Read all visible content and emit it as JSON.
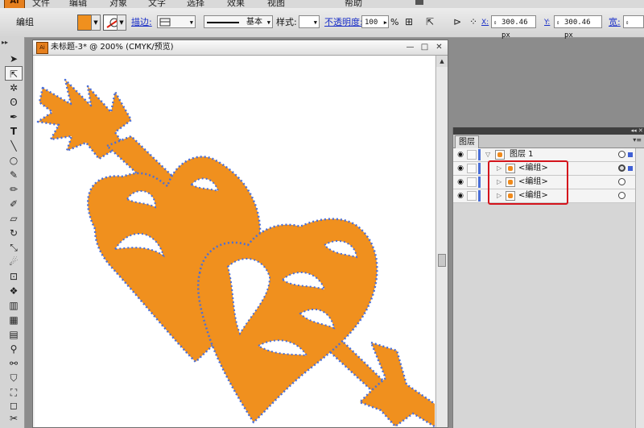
{
  "app": {
    "logo": "Ai",
    "menu": [
      "文件",
      "编辑",
      "对象",
      "文字",
      "选择",
      "效果",
      "视图",
      "帮助"
    ]
  },
  "control_bar": {
    "selection_label": "编组",
    "fill_color": "#f0901e",
    "stroke_label": "描边:",
    "stroke_profile": "基本",
    "style_label": "样式:",
    "opacity_label": "不透明度:",
    "opacity_value": "100",
    "opacity_unit": "%",
    "x_label": "X:",
    "x_value": "300.46 px",
    "y_label": "Y:",
    "y_value": "300.46 px",
    "width_label": "宽:"
  },
  "document": {
    "title": "未标题-3* @ 200% (CMYK/预览)"
  },
  "layers_panel": {
    "tab": "图层",
    "layer": {
      "name": "图层 1"
    },
    "items": [
      {
        "name": "<编组>",
        "targeted": true
      },
      {
        "name": "<编组>",
        "targeted": false
      },
      {
        "name": "<编组>",
        "targeted": false
      }
    ]
  },
  "colors": {
    "artwork_fill": "#f0901e",
    "selection_blue": "#4a6fd8",
    "highlight_red": "#d4141c"
  }
}
